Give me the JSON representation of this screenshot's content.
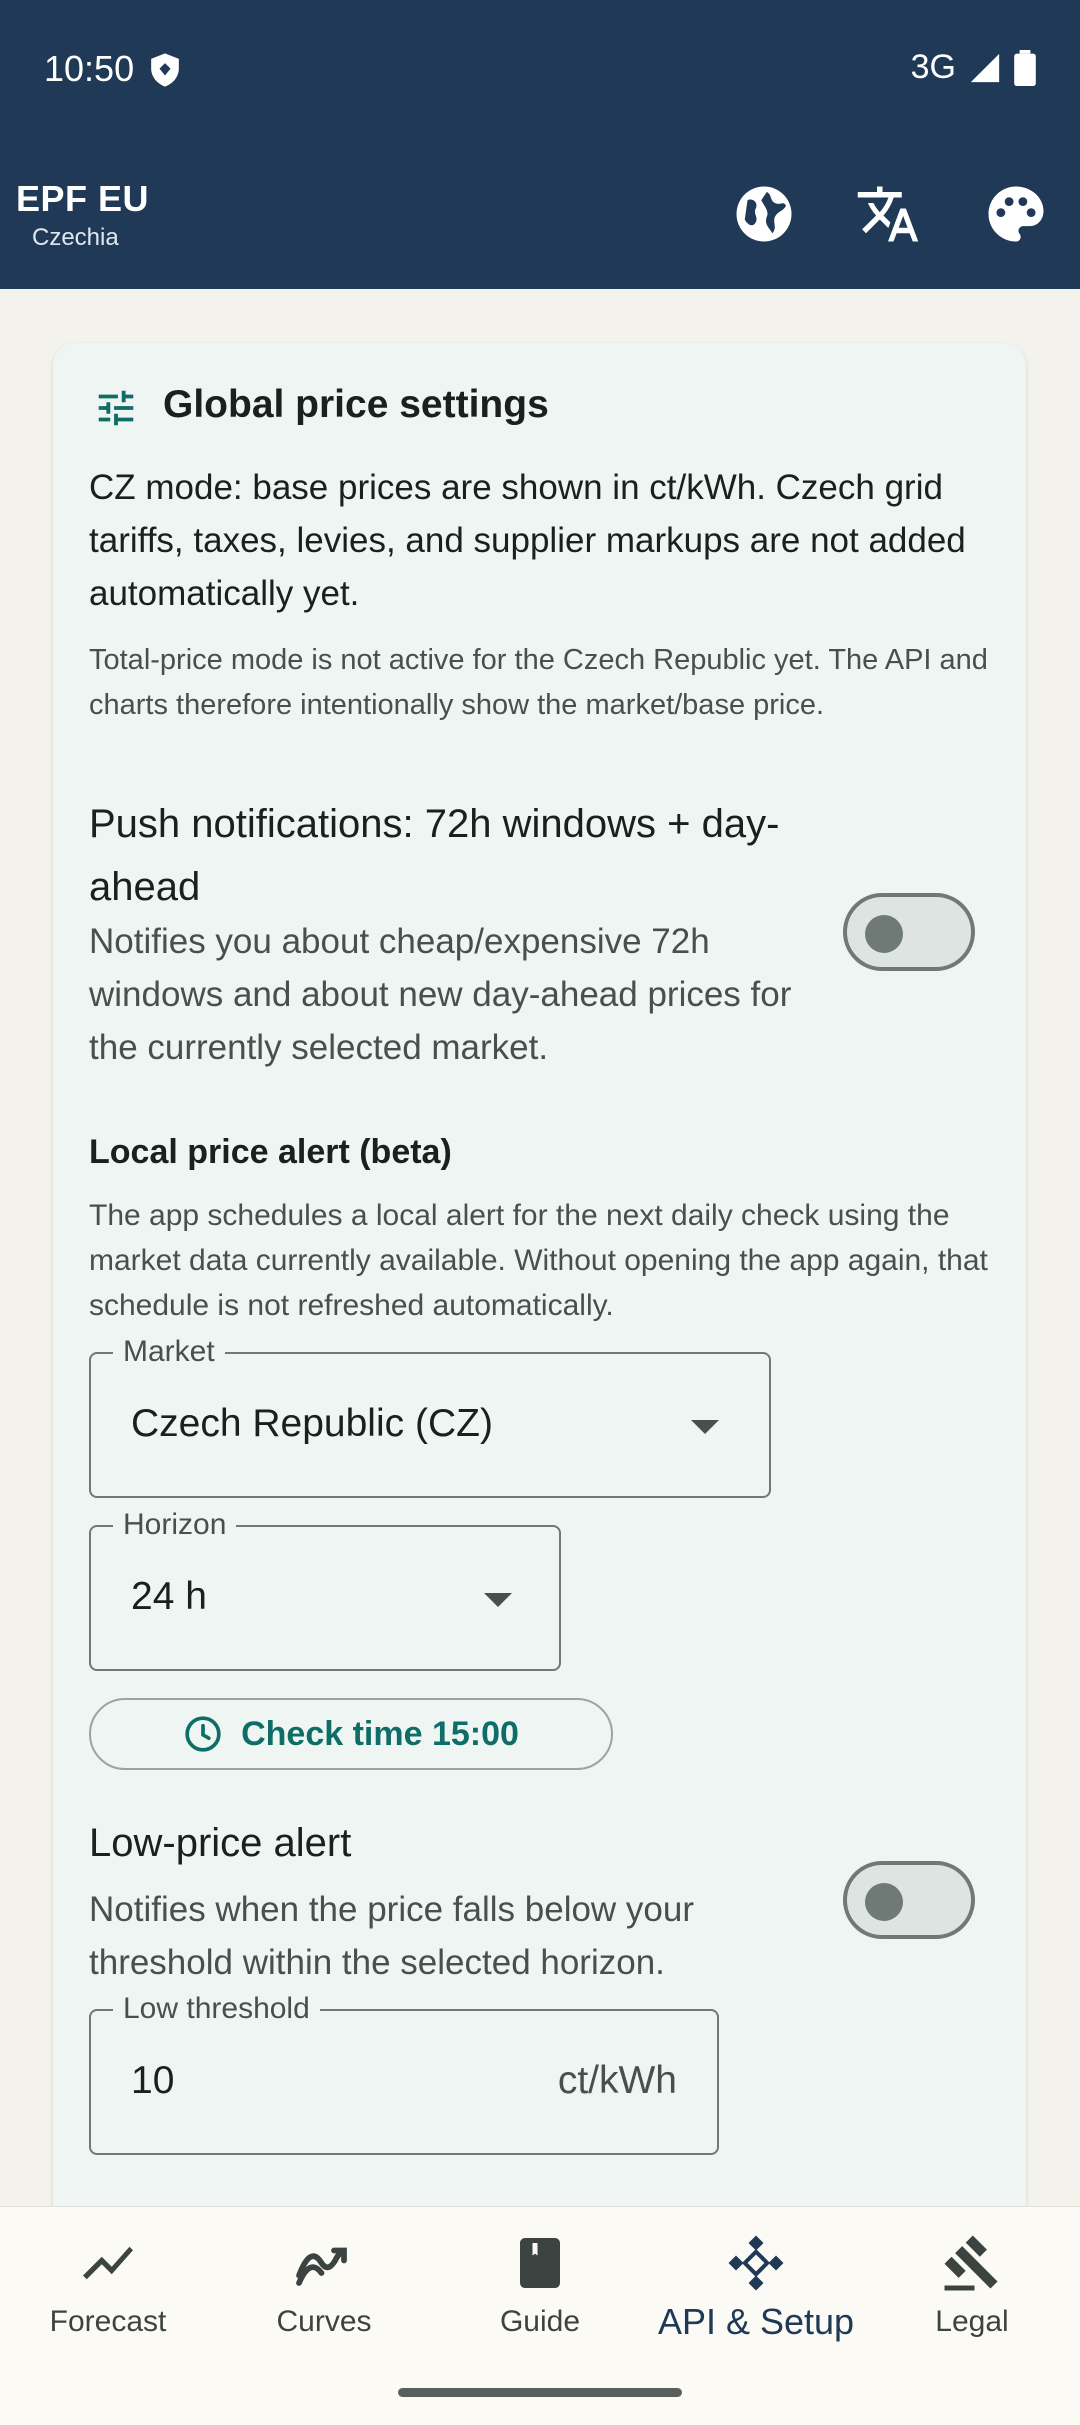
{
  "status_bar": {
    "time": "10:50",
    "network": "3G"
  },
  "header": {
    "title": "EPF EU",
    "subtitle": "Czechia",
    "icons": [
      "globe-icon",
      "translate-icon",
      "palette-icon"
    ]
  },
  "card": {
    "title": "Global price settings",
    "cz_mode_text": "CZ mode: base prices are shown in ct/kWh. Czech grid tariffs, taxes, levies, and supplier markups are not added automatically yet.",
    "total_price_note": "Total-price mode is not active for the Czech Republic yet. The API and charts therefore intentionally show the market/base price.",
    "push": {
      "title": "Push notifications: 72h windows + day-ahead",
      "description": "Notifies you about cheap/expensive 72h windows and about new day-ahead prices for the currently selected market.",
      "enabled": false
    },
    "local_alert": {
      "title": "Local price alert (beta)",
      "description": "The app schedules a local alert for the next daily check using the market data currently available. Without opening the app again, that schedule is not refreshed automatically."
    },
    "market": {
      "label": "Market",
      "value": "Czech Republic (CZ)"
    },
    "horizon": {
      "label": "Horizon",
      "value": "24 h"
    },
    "check_time_button": "Check time 15:00",
    "low_price": {
      "title": "Low-price alert",
      "description": "Notifies when the price falls below your threshold within the selected horizon.",
      "enabled": false
    },
    "low_threshold": {
      "label": "Low threshold",
      "value": "10",
      "unit": "ct/kWh"
    }
  },
  "nav": {
    "items": [
      {
        "label": "Forecast",
        "icon": "trend-icon"
      },
      {
        "label": "Curves",
        "icon": "curves-icon"
      },
      {
        "label": "Guide",
        "icon": "book-icon"
      },
      {
        "label": "API & Setup",
        "icon": "api-icon"
      },
      {
        "label": "Legal",
        "icon": "gavel-icon"
      }
    ],
    "active": "API & Setup"
  },
  "colors": {
    "header_bg": "#203956",
    "accent": "#0e6d66",
    "card_bg": "#eef5f3"
  }
}
